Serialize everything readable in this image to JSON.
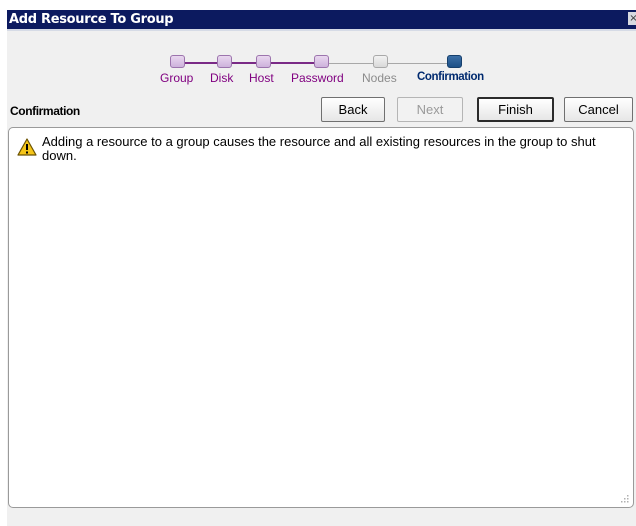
{
  "window": {
    "title": "Add Resource To Group",
    "close_symbol": "×"
  },
  "wizard": {
    "steps": [
      {
        "label": "Group",
        "state": "done"
      },
      {
        "label": "Disk",
        "state": "done"
      },
      {
        "label": "Host",
        "state": "done"
      },
      {
        "label": "Password",
        "state": "done"
      },
      {
        "label": "Nodes",
        "state": "inactive"
      },
      {
        "label": "Confirmation",
        "state": "current"
      }
    ]
  },
  "page": {
    "section_title": "Confirmation",
    "message": "Adding a resource to a group causes the resource and all existing resources in the group to shut down."
  },
  "buttons": {
    "back": "Back",
    "next": "Next",
    "finish": "Finish",
    "cancel": "Cancel"
  },
  "icons": {
    "warning": "warning-icon",
    "close": "close-icon",
    "resize": "resize-grip-icon"
  },
  "colors": {
    "titlebar": "#0c1a5f",
    "step_done": "#800080",
    "step_current": "#002a6f",
    "step_inactive": "#8c8c8c"
  }
}
